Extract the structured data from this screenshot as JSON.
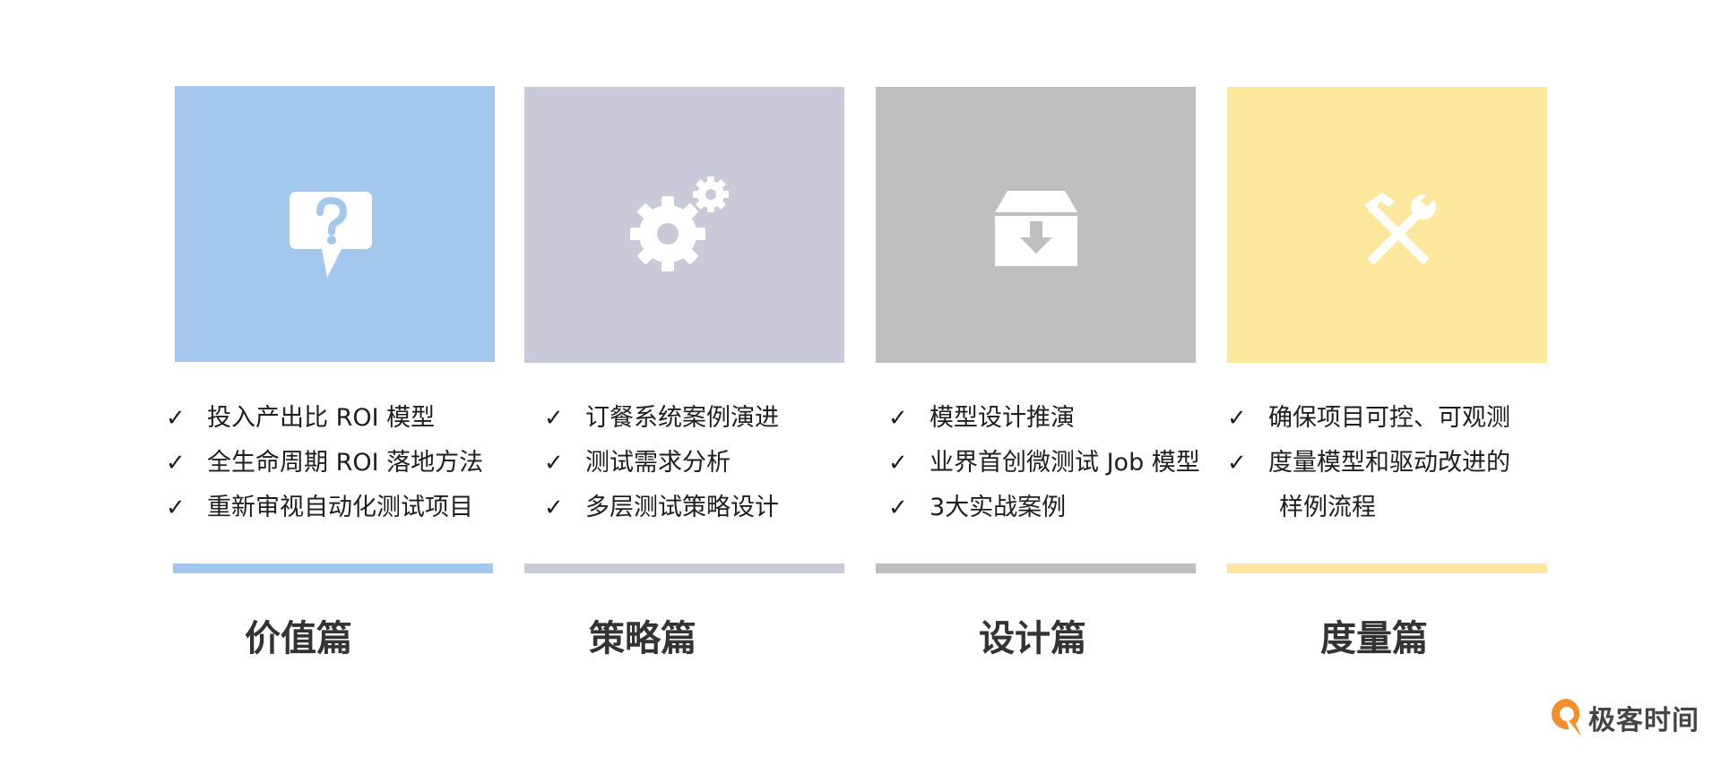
{
  "colors": {
    "value": "#a4c7ee",
    "strategy": "#c9c9da",
    "design": "#bfbfbf",
    "measure": "#fde79c",
    "logo_orange": "#f08f2c"
  },
  "columns": [
    {
      "icon": "question-bubble-icon",
      "items": [
        {
          "check": "✓",
          "text": "投入产出比 ROI 模型"
        },
        {
          "check": "✓",
          "text": "全生命周期 ROI 落地方法"
        },
        {
          "check": "✓",
          "text": "重新审视自动化测试项目"
        }
      ],
      "title": "价值篇"
    },
    {
      "icon": "gears-icon",
      "items": [
        {
          "check": "✓",
          "text": "订餐系统案例演进"
        },
        {
          "check": "✓",
          "text": "测试需求分析"
        },
        {
          "check": "✓",
          "text": "多层测试策略设计"
        }
      ],
      "title": "策略篇"
    },
    {
      "icon": "archive-download-icon",
      "items": [
        {
          "check": "✓",
          "text": "模型设计推演"
        },
        {
          "check": "✓",
          "text": "业界首创微测试 Job 模型"
        },
        {
          "check": "✓",
          "text": "3大实战案例"
        }
      ],
      "title": "设计篇"
    },
    {
      "icon": "hammer-wrench-icon",
      "items": [
        {
          "check": "✓",
          "text": "确保项目可控、可观测"
        },
        {
          "check": "✓",
          "text": "度量模型和驱动改进的"
        },
        {
          "check": "",
          "text": "样例流程"
        }
      ],
      "title": "度量篇"
    }
  ],
  "logo": {
    "icon": "geektime-logo-icon",
    "text": "极客时间"
  }
}
